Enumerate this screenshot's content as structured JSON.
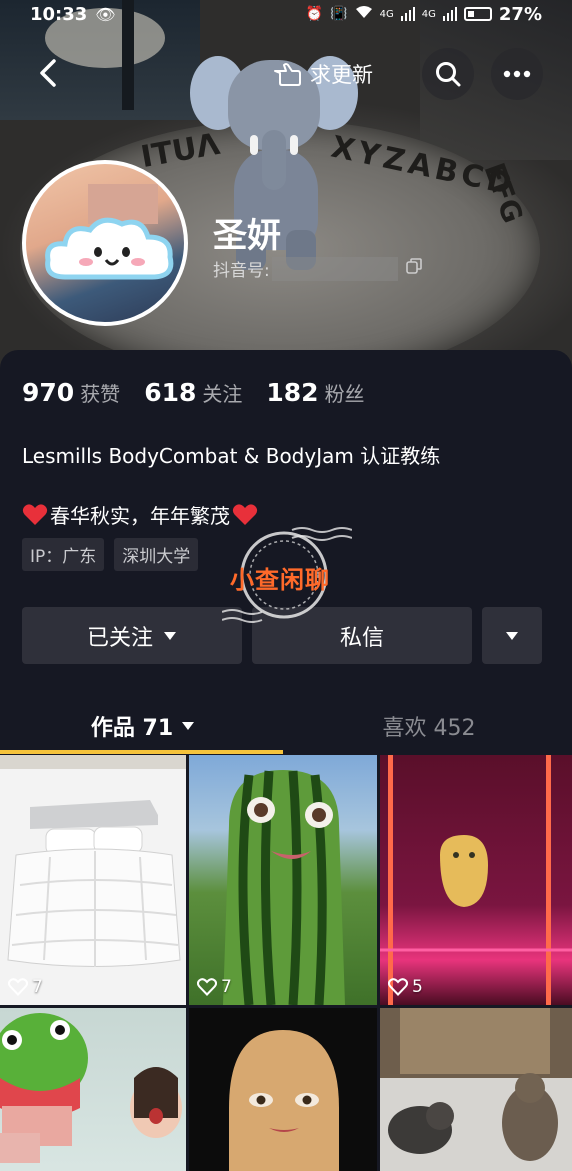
{
  "status_bar": {
    "time": "10:33",
    "network": "4G",
    "network2": "4G",
    "battery": "27%"
  },
  "header": {
    "update_label": "求更新"
  },
  "profile": {
    "name": "圣妍",
    "douyin_id_label": "抖音号:"
  },
  "stats": [
    {
      "value": "970",
      "label": "获赞"
    },
    {
      "value": "618",
      "label": "关注"
    },
    {
      "value": "182",
      "label": "粉丝"
    }
  ],
  "bio": {
    "line1": "Lesmills BodyCombat & BodyJam  认证教练",
    "line2": "春华秋实，年年繁茂"
  },
  "tags": [
    "IP：广东",
    "深圳大学"
  ],
  "actions": {
    "follow_label": "已关注",
    "message_label": "私信"
  },
  "tabs": [
    {
      "label": "作品 71"
    },
    {
      "label": "喜欢 452"
    }
  ],
  "videos": [
    {
      "likes": "7",
      "icon": "bed-thumbnail"
    },
    {
      "likes": "7",
      "icon": "watermelon-face-thumbnail"
    },
    {
      "likes": "5",
      "icon": "potato-neon-thumbnail"
    },
    {
      "likes": "",
      "icon": "frog-hat-thumbnail"
    },
    {
      "likes": "",
      "icon": "potato-face-thumbnail"
    },
    {
      "likes": "",
      "icon": "cats-thumbnail"
    }
  ],
  "watermark": "小查闲聊",
  "colors": {
    "background": "#161823",
    "tab_indicator": "#f5c33c",
    "button_bg": "#2f303a",
    "tag_bg": "#2b2c36",
    "heart": "#e8303a",
    "watermark": "#ff6a2a"
  }
}
